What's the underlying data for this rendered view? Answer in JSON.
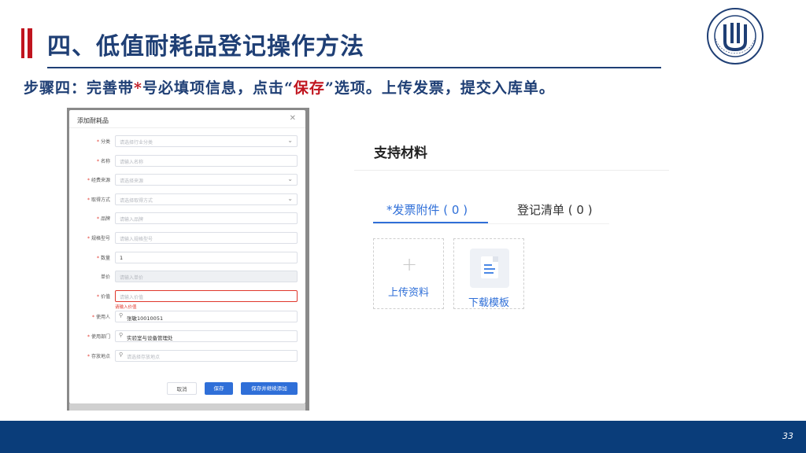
{
  "slide": {
    "title": "四、低值耐耗品登记操作方法",
    "subtitle_before": "步骤四：完善带",
    "subtitle_star": "*",
    "subtitle_middle": "号必填项信息，点击“",
    "subtitle_highlight": "保存",
    "subtitle_after": "”选项。上传发票，提交入库单。",
    "page_number": "33",
    "colors": {
      "title": "#1f3f75",
      "accent_red": "#c0141e",
      "footer": "#0a3d7a",
      "primary_blue": "#2f6fd8"
    }
  },
  "logo": {
    "icon": "shanghai-university-seal-icon",
    "text": "SHANGHAI UNIVERSITY"
  },
  "dialog": {
    "title": "添加耐耗品",
    "close_icon": "close-icon",
    "fields": [
      {
        "label": "分类",
        "required": true,
        "type": "select",
        "placeholder": "请选择行业分类",
        "value": ""
      },
      {
        "label": "名称",
        "required": true,
        "type": "text",
        "placeholder": "请输入名称",
        "value": ""
      },
      {
        "label": "经费来源",
        "required": true,
        "type": "select",
        "placeholder": "请选择来源",
        "value": ""
      },
      {
        "label": "取得方式",
        "required": true,
        "type": "select",
        "placeholder": "请选择取得方式",
        "value": ""
      },
      {
        "label": "品牌",
        "required": true,
        "type": "text",
        "placeholder": "请输入品牌",
        "value": ""
      },
      {
        "label": "规格型号",
        "required": true,
        "type": "text",
        "placeholder": "请输入规格型号",
        "value": ""
      },
      {
        "label": "数量",
        "required": true,
        "type": "text",
        "placeholder": "",
        "value": "1"
      },
      {
        "label": "单价",
        "required": false,
        "type": "disabled",
        "placeholder": "请输入单价",
        "value": ""
      },
      {
        "label": "价值",
        "required": true,
        "type": "error",
        "placeholder": "请输入价值",
        "value": "",
        "error": "请输入价值"
      },
      {
        "label": "使用人",
        "required": true,
        "type": "search",
        "placeholder": "",
        "value": "张敏10010051"
      },
      {
        "label": "使用部门",
        "required": true,
        "type": "search",
        "placeholder": "",
        "value": "实验室与设备管理处"
      },
      {
        "label": "存放地点",
        "required": true,
        "type": "search",
        "placeholder": "请选择存放地点",
        "value": ""
      }
    ],
    "buttons": {
      "cancel": "取消",
      "save": "保存",
      "save_and_add": "保存并继续添加"
    }
  },
  "materials": {
    "title": "支持材料",
    "tabs": [
      {
        "label": "*发票附件 ( 0 )",
        "active": true
      },
      {
        "label": "登记清单 ( 0 )",
        "active": false
      }
    ],
    "upload_label": "上传资料",
    "upload_icon": "plus-icon",
    "download_label": "下载模板",
    "download_icon": "document-icon"
  }
}
